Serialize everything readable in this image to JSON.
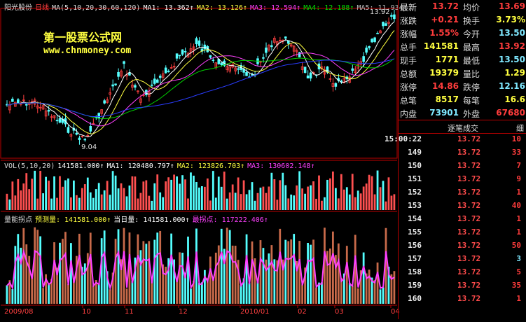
{
  "colors": {
    "red": "#ff3c3c",
    "green": "#00d000",
    "cyan": "#7fe8ff",
    "yellow": "#ffff40",
    "magenta": "#ff40ff",
    "blue": "#2a3cff",
    "white": "#ffffff"
  },
  "header": {
    "stock": "阳光股份",
    "period": "日线",
    "ma_params": "MA(5,10,20,30,60,120)",
    "ma1": "MA1: 13.362↑",
    "ma2": "MA2: 13.126↑",
    "ma3": "MA3: 12.594↑",
    "ma4": "MA4: 12.188↑",
    "ma5": "MA5: 11.934↑"
  },
  "watermark": {
    "line1": "第一股票公式网",
    "line2": "www.chnmoney.com"
  },
  "price_labels": {
    "high": "13.92",
    "low": "9.04"
  },
  "vol_panel": {
    "params": "VOL(5,10,20)",
    "vol": "141581.000↑",
    "ma1": "MA1: 120480.797↑",
    "ma2": "MA2: 123826.703↑",
    "ma3": "MA3: 130602.148↑"
  },
  "ind_panel": {
    "name": "量能拐点",
    "forecast": "预测量: 141581.000↑",
    "today": "当日量: 141581.000↑",
    "turn": "最拐点: 117222.406↑"
  },
  "x_axis": [
    "2009/08",
    "10",
    "11",
    "12",
    "2010/01",
    "02",
    "03",
    "04"
  ],
  "quote": {
    "rows": [
      {
        "l1": "最新",
        "v1": "13.72",
        "c1": "red",
        "l2": "均价",
        "v2": "13.69",
        "c2": "red"
      },
      {
        "l1": "涨跌",
        "v1": "+0.21",
        "c1": "red",
        "l2": "换手",
        "v2": "3.73%",
        "c2": "yellow"
      },
      {
        "l1": "涨幅",
        "v1": "1.55%",
        "c1": "red",
        "l2": "今开",
        "v2": "13.50",
        "c2": "cyan"
      },
      {
        "l1": "总手",
        "v1": "141581",
        "c1": "yellow",
        "l2": "最高",
        "v2": "13.92",
        "c2": "red"
      },
      {
        "l1": "现手",
        "v1": "1771",
        "c1": "yellow",
        "l2": "最低",
        "v2": "13.50",
        "c2": "cyan"
      },
      {
        "l1": "总额",
        "v1": "19379",
        "c1": "yellow",
        "l2": "量比",
        "v2": "1.29",
        "c2": "yellow"
      },
      {
        "l1": "涨停",
        "v1": "14.86",
        "c1": "red",
        "l2": "跌停",
        "v2": "12.16",
        "c2": "cyan"
      },
      {
        "l1": "总笔",
        "v1": "8517",
        "c1": "yellow",
        "l2": "每笔",
        "v2": "16.6",
        "c2": "yellow"
      },
      {
        "l1": "内盘",
        "v1": "73901",
        "c1": "cyan",
        "l2": "外盘",
        "v2": "67680",
        "c2": "red"
      }
    ]
  },
  "trades": {
    "title": "逐笔成交",
    "detail": "细",
    "rows": [
      {
        "t": "15:00:22",
        "p": "13.72",
        "v": "10",
        "c": "red"
      },
      {
        "t": "149",
        "p": "13.72",
        "v": "33",
        "c": "red"
      },
      {
        "t": "150",
        "p": "13.72",
        "v": "7",
        "c": "red"
      },
      {
        "t": "151",
        "p": "13.72",
        "v": "9",
        "c": "red"
      },
      {
        "t": "152",
        "p": "13.72",
        "v": "1",
        "c": "red"
      },
      {
        "t": "153",
        "p": "13.72",
        "v": "40",
        "c": "red"
      },
      {
        "t": "154",
        "p": "13.72",
        "v": "1",
        "c": "red"
      },
      {
        "t": "155",
        "p": "13.72",
        "v": "1",
        "c": "red"
      },
      {
        "t": "156",
        "p": "13.72",
        "v": "50",
        "c": "red"
      },
      {
        "t": "157",
        "p": "13.72",
        "v": "3",
        "c": "cyan"
      },
      {
        "t": "158",
        "p": "13.72",
        "v": "5",
        "c": "red"
      },
      {
        "t": "159",
        "p": "13.72",
        "v": "35",
        "c": "red"
      },
      {
        "t": "160",
        "p": "13.72",
        "v": "1",
        "c": "red"
      }
    ]
  }
}
